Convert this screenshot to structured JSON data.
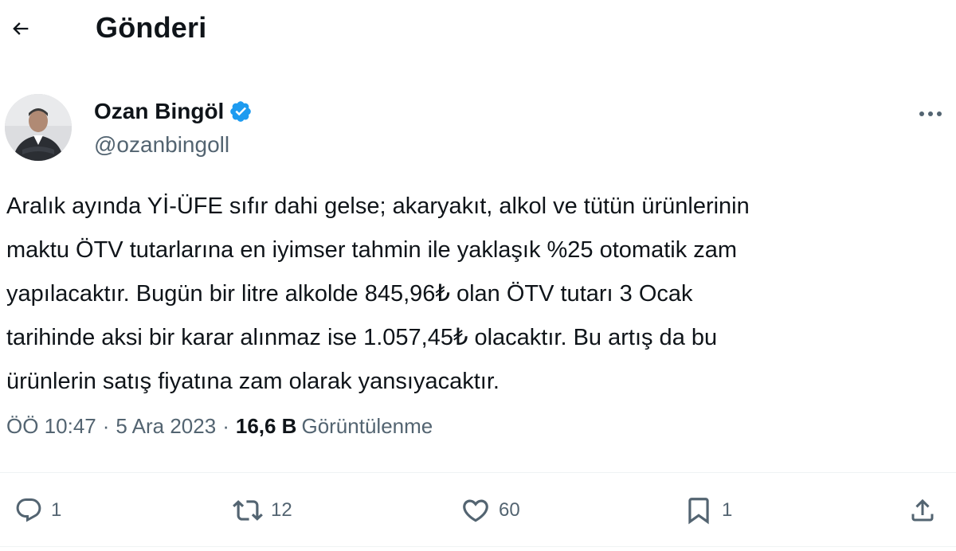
{
  "header": {
    "title": "Gönderi",
    "back_icon": "arrow-left-icon"
  },
  "author": {
    "name": "Ozan Bingöl",
    "handle": "@ozanbingoll",
    "verified": true,
    "verified_color": "#1d9bf0",
    "more_icon": "more-horizontal-icon"
  },
  "post": {
    "text": "Aralık ayında Yİ-ÜFE sıfır dahi gelse; akaryakıt, alkol ve tütün ürünlerinin\nmaktu ÖTV tutarlarına en iyimser tahmin ile yaklaşık %25 otomatik zam\nyapılacaktır. Bugün bir litre alkolde 845,96₺ olan ÖTV tutarı 3 Ocak\ntarihinde aksi bir karar alınmaz ise 1.057,45₺ olacaktır. Bu artış da bu\nürünlerin satış fiyatına zam olarak yansıyacaktır.",
    "time": "ÖÖ 10:47",
    "date": "5 Ara 2023",
    "separator": "·",
    "views_count": "16,6 B",
    "views_label": "Görüntülenme"
  },
  "actions": {
    "reply": {
      "icon": "reply-icon",
      "count": "1"
    },
    "repost": {
      "icon": "repost-icon",
      "count": "12"
    },
    "like": {
      "icon": "heart-icon",
      "count": "60"
    },
    "bookmark": {
      "icon": "bookmark-icon",
      "count": "1"
    },
    "share": {
      "icon": "share-icon"
    }
  },
  "colors": {
    "text_primary": "#0f1419",
    "text_secondary": "#536471",
    "divider": "#eff3f4"
  }
}
